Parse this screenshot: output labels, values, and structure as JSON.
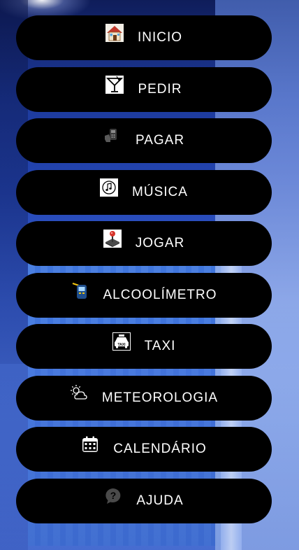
{
  "menu": {
    "items": [
      {
        "id": "inicio",
        "label": "INICIO",
        "icon": "home-icon"
      },
      {
        "id": "pedir",
        "label": "PEDIR",
        "icon": "cocktail-glass-icon"
      },
      {
        "id": "pagar",
        "label": "PAGAR",
        "icon": "payment-terminal-icon"
      },
      {
        "id": "musica",
        "label": "MÚSICA",
        "icon": "music-note-icon"
      },
      {
        "id": "jogar",
        "label": "JOGAR",
        "icon": "joystick-icon"
      },
      {
        "id": "alcoolimetro",
        "label": "ALCOOLÍMETRO",
        "icon": "breathalyzer-icon"
      },
      {
        "id": "taxi",
        "label": "TAXI",
        "icon": "taxi-icon"
      },
      {
        "id": "meteorologia",
        "label": "METEOROLOGIA",
        "icon": "weather-icon"
      },
      {
        "id": "calendario",
        "label": "CALENDÁRIO",
        "icon": "calendar-icon"
      },
      {
        "id": "ajuda",
        "label": "AJUDA",
        "icon": "help-icon"
      }
    ]
  },
  "colors": {
    "button_bg": "#000000",
    "button_text": "#ffffff",
    "background_top": "#0f1d5a",
    "background_bottom": "#5b86ea"
  }
}
